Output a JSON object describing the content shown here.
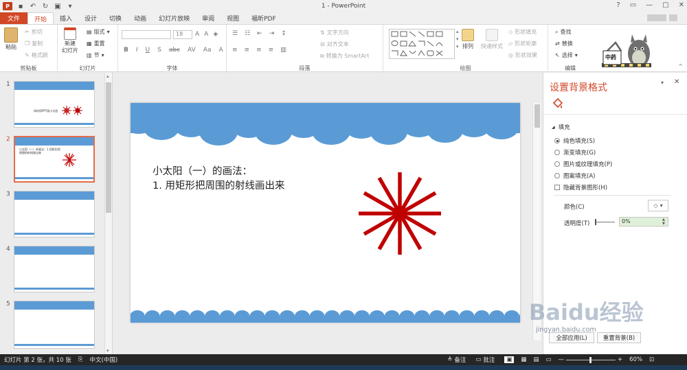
{
  "window": {
    "title": "1 - PowerPoint",
    "app_icon": "P",
    "controls": [
      "?",
      "▭",
      "—",
      "▢",
      "✕"
    ]
  },
  "tabs": [
    "文件",
    "开始",
    "插入",
    "设计",
    "切换",
    "动画",
    "幻灯片放映",
    "审阅",
    "视图",
    "福昕PDF"
  ],
  "active_tab": "开始",
  "ribbon": {
    "clipboard": {
      "label": "剪贴板",
      "paste": "粘贴",
      "cut": "剪切",
      "copy": "复制",
      "format_painter": "格式刷"
    },
    "slides": {
      "label": "幻灯片",
      "new_slide": "新建\n幻灯片",
      "layout": "版式",
      "reset": "重置",
      "section": "节"
    },
    "font": {
      "label": "字体",
      "font_size": "18"
    },
    "paragraph": {
      "label": "段落",
      "text_direction": "文字方向",
      "align_text": "对齐文本",
      "smartart": "转换为 SmartArt"
    },
    "drawing": {
      "label": "绘图",
      "arrange": "排列",
      "quick_styles": "快速样式",
      "shape_fill": "形状填充",
      "shape_outline": "形状轮廓",
      "shape_effects": "形状效果"
    },
    "editing": {
      "label": "编辑",
      "find": "查找",
      "replace": "替换",
      "select": "选择"
    },
    "logo_text": "中药"
  },
  "thumbnails": [
    {
      "num": "1",
      "text": "如何用PPT画小太阳"
    },
    {
      "num": "2",
      "text": "小太阳（一）的画法：1.用矩形把周围的射线画出来"
    },
    {
      "num": "3",
      "text": ""
    },
    {
      "num": "4",
      "text": ""
    },
    {
      "num": "5",
      "text": ""
    }
  ],
  "selected_thumb": 2,
  "slide": {
    "line1": "小太阳（一）的画法：",
    "line2": "1. 用矩形把周围的射线画出来",
    "cloud_color": "#5b9bd5",
    "sun_color": "#c00000",
    "ray_count": 12
  },
  "format_pane": {
    "title": "设置背景格式",
    "section": "填充",
    "options": [
      "纯色填充(S)",
      "渐变填充(G)",
      "图片或纹理填充(P)",
      "图案填充(A)"
    ],
    "selected_option": 0,
    "hide_graphics": "隐藏背景图形(H)",
    "color_label": "颜色(C)",
    "transparency_label": "透明度(T)",
    "transparency_value": "0%",
    "apply_all": "全部应用(L)",
    "reset_bg": "重置背景(B)"
  },
  "status": {
    "slide_info": "幻灯片 第 2 张，共 10 张",
    "language": "中文(中国)",
    "notes": "备注",
    "comments": "批注",
    "zoom": "60%"
  },
  "watermark": {
    "brand": "Baidu经验",
    "url": "jingyan.baidu.com"
  }
}
